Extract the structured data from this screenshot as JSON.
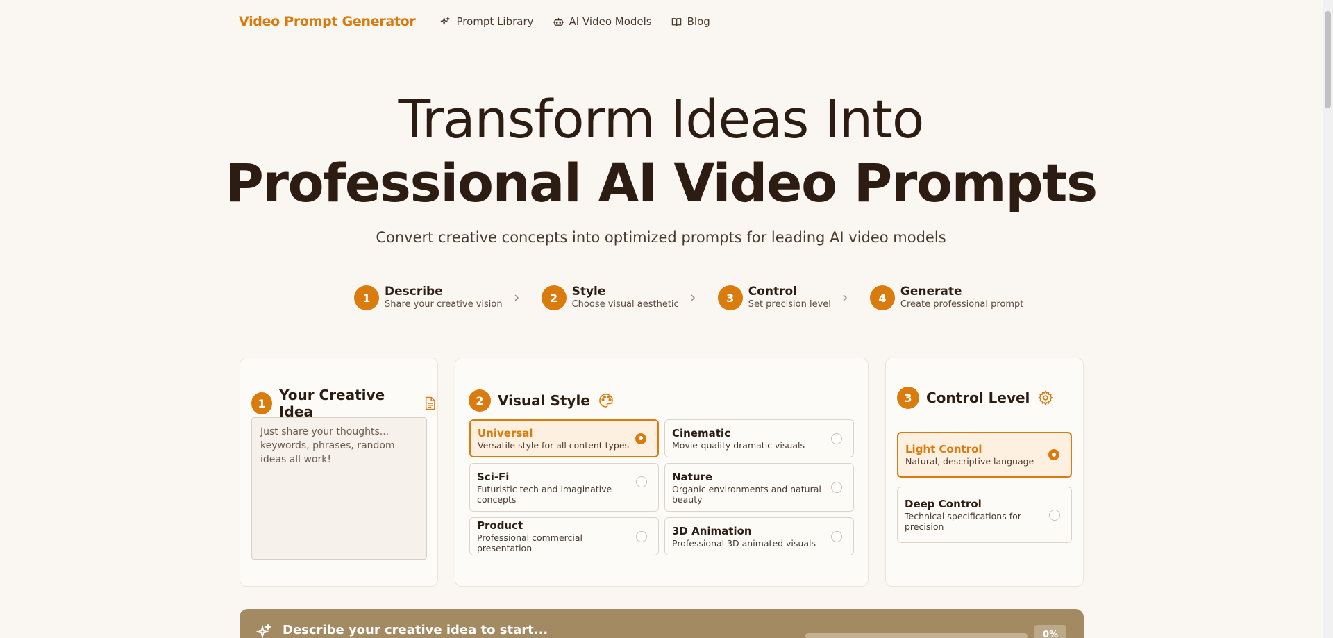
{
  "header": {
    "brand": "Video Prompt Generator",
    "nav": [
      {
        "label": "Prompt Library",
        "icon": "sparkles-icon"
      },
      {
        "label": "AI Video Models",
        "icon": "robot-icon"
      },
      {
        "label": "Blog",
        "icon": "book-icon"
      }
    ]
  },
  "hero": {
    "line1": "Transform Ideas Into",
    "line2": "Professional AI Video Prompts",
    "subtitle": "Convert creative concepts into optimized prompts for leading AI video models"
  },
  "steps": [
    {
      "num": "1",
      "title": "Describe",
      "desc": "Share your creative vision"
    },
    {
      "num": "2",
      "title": "Style",
      "desc": "Choose visual aesthetic"
    },
    {
      "num": "3",
      "title": "Control",
      "desc": "Set precision level"
    },
    {
      "num": "4",
      "title": "Generate",
      "desc": "Create professional prompt"
    }
  ],
  "idea_card": {
    "num": "1",
    "title": "Your Creative Idea",
    "icon": "document-icon",
    "placeholder": "Just share your thoughts... keywords, phrases, random ideas all work!",
    "value": ""
  },
  "style_card": {
    "num": "2",
    "title": "Visual Style",
    "icon": "palette-icon",
    "selected": "Universal",
    "options": [
      {
        "title": "Universal",
        "desc": "Versatile style for all content types"
      },
      {
        "title": "Cinematic",
        "desc": "Movie-quality dramatic visuals"
      },
      {
        "title": "Sci-Fi",
        "desc": "Futuristic tech and imaginative concepts"
      },
      {
        "title": "Nature",
        "desc": "Organic environments and natural beauty"
      },
      {
        "title": "Product",
        "desc": "Professional commercial presentation"
      },
      {
        "title": "3D Animation",
        "desc": "Professional 3D animated visuals"
      }
    ]
  },
  "control_card": {
    "num": "3",
    "title": "Control Level",
    "icon": "gear-icon",
    "selected": "Light Control",
    "options": [
      {
        "title": "Light Control",
        "desc": "Natural, descriptive language"
      },
      {
        "title": "Deep Control",
        "desc": "Technical specifications for precision"
      }
    ]
  },
  "status": {
    "icon": "sparkles-icon",
    "text": "Describe your creative idea to start...",
    "progress_percent": 0,
    "progress_label": "0%"
  },
  "colors": {
    "accent": "#d97b0d",
    "background": "#faf7f2",
    "text": "#2d1c12",
    "status_bar": "#a48a62"
  }
}
